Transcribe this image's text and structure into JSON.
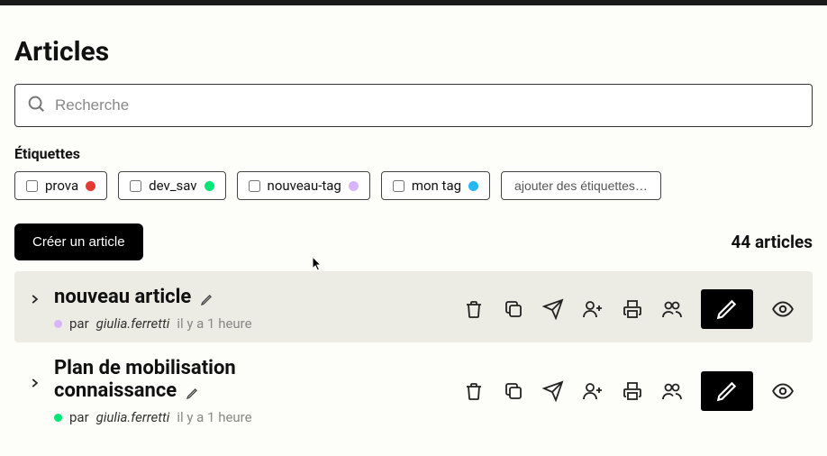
{
  "page": {
    "title": "Articles"
  },
  "search": {
    "placeholder": "Recherche"
  },
  "tags": {
    "label": "Étiquettes",
    "items": [
      {
        "name": "prova",
        "color": "#e53935"
      },
      {
        "name": "dev_sav",
        "color": "#00e676"
      },
      {
        "name": "nouveau-tag",
        "color": "#d8b4fe"
      },
      {
        "name": "mon tag",
        "color": "#29b6f6"
      }
    ],
    "add_label": "ajouter des étiquettes…"
  },
  "actions": {
    "create_label": "Créer un article"
  },
  "count": {
    "text": "44 articles"
  },
  "articles": [
    {
      "title": "nouveau article",
      "dot_color": "#d8b4fe",
      "by": "par",
      "author": "giulia.ferretti",
      "ago": "il y a 1 heure"
    },
    {
      "title": "Plan de mobilisation connaissance",
      "dot_color": "#00e676",
      "by": "par",
      "author": "giulia.ferretti",
      "ago": "il y a 1 heure"
    }
  ]
}
